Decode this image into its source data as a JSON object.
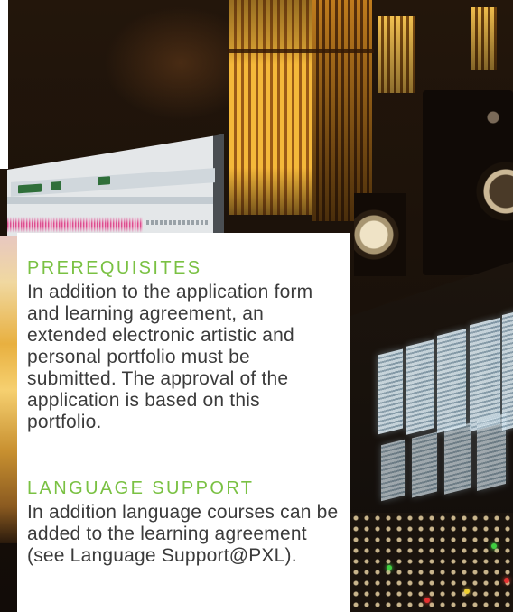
{
  "colors": {
    "heading": "#7ac143",
    "body_text": "#3b3b3b",
    "panel_background": "#ffffff"
  },
  "sections": [
    {
      "heading": "PREREQUISITES",
      "lines": [
        "In addition to the application form",
        "and learning agreement, an",
        "extended electronic artistic and",
        "personal portfolio must be",
        "submitted. The approval of the",
        "application is based on this",
        "portfolio."
      ]
    },
    {
      "heading": "LANGUAGE SUPPORT",
      "lines": [
        "In addition language courses can be",
        "added to the learning agreement",
        "(see Language Support@PXL)."
      ]
    }
  ]
}
